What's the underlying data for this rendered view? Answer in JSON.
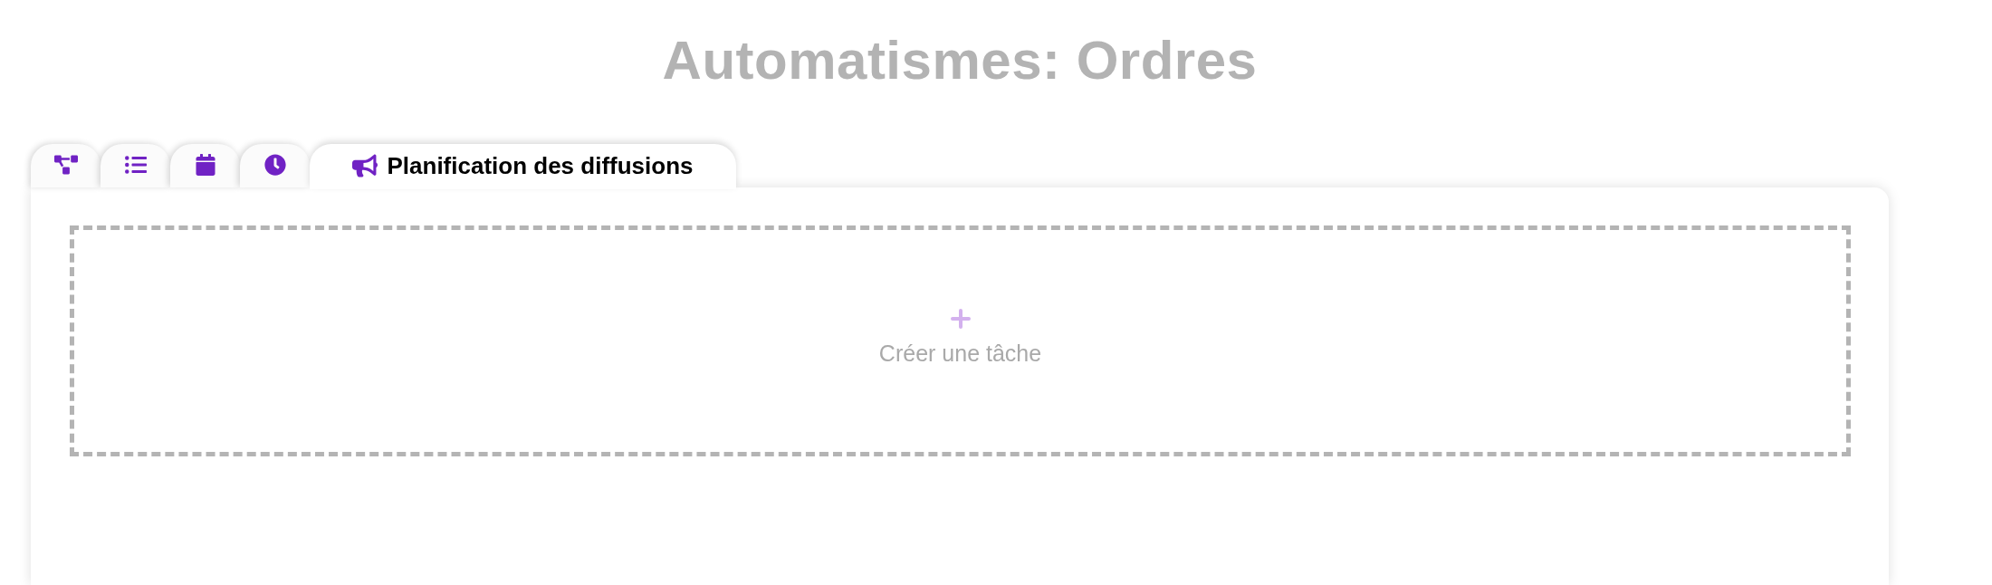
{
  "title": "Automatismes: Ordres",
  "tabs": [
    {
      "selected": false
    },
    {
      "selected": false
    },
    {
      "selected": false
    },
    {
      "selected": false
    },
    {
      "label": "Planification des diffusions",
      "selected": true
    }
  ],
  "create_task": {
    "label": "Créer une tâche"
  }
}
